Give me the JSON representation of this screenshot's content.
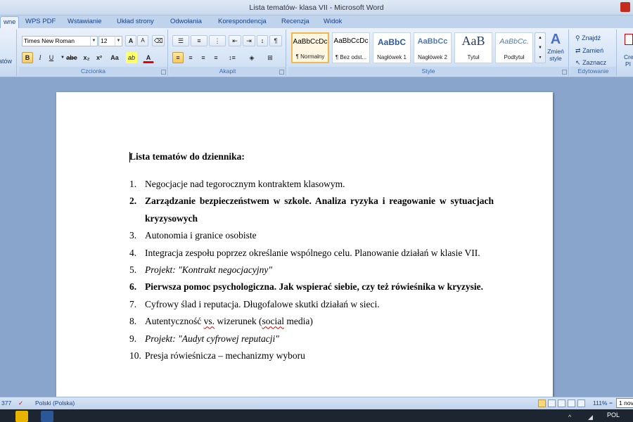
{
  "window": {
    "title": "Lista tematów- klasa VII - Microsoft Word"
  },
  "ribbon": {
    "tabs": [
      {
        "label": "wne",
        "active": true
      },
      {
        "label": "WPS PDF"
      },
      {
        "label": "Wstawianie"
      },
      {
        "label": "Układ strony"
      },
      {
        "label": "Odwołania"
      },
      {
        "label": "Korespondencja"
      },
      {
        "label": "Recenzja"
      },
      {
        "label": "Widok"
      }
    ],
    "clipboard_partial_label": "atów",
    "font": {
      "name": "Times New Roman",
      "size": "12",
      "group_label": "Czcionka",
      "grow": "A",
      "shrink": "A",
      "bold": "B",
      "italic": "I",
      "underline": "U",
      "strike": "abe",
      "subscript": "x₂",
      "superscript": "x²",
      "change_case": "Aa",
      "highlight": "ab",
      "font_color": "A"
    },
    "paragraph": {
      "group_label": "Akapit"
    },
    "styles": {
      "group_label": "Style",
      "items": [
        {
          "preview": "AaBbCcDc",
          "name": "¶ Normalny",
          "selected": true
        },
        {
          "preview": "AaBbCcDc",
          "name": "¶ Bez odst..."
        },
        {
          "preview": "AaBbC",
          "name": "Nagłówek 1"
        },
        {
          "preview": "AaBbCc",
          "name": "Nagłówek 2"
        },
        {
          "preview": "AaB",
          "name": "Tytuł"
        },
        {
          "preview": "AaBbCc.",
          "name": "Podtytuł"
        }
      ],
      "change_styles": [
        "Zmień",
        "style"
      ]
    },
    "editing": {
      "group_label": "Edytowanie",
      "find": "Znajdź",
      "replace": "Zamień",
      "select": "Zaznacz"
    },
    "pdf_partial": [
      "Cre",
      "PI"
    ]
  },
  "document": {
    "title": "Lista tematów do dziennika:",
    "items": [
      {
        "num": "1.",
        "text": "Negocjacje nad tegorocznym kontraktem klasowym.",
        "style": "normal"
      },
      {
        "num": "2.",
        "text": "Zarządzanie bezpieczeństwem w szkole. Analiza ryzyka i reagowanie w sytuacjach kryzysowych",
        "style": "bold"
      },
      {
        "num": "3.",
        "text": "Autonomia i granice osobiste",
        "style": "normal"
      },
      {
        "num": "4.",
        "text": "Integracja zespołu poprzez określanie wspólnego celu. Planowanie działań w klasie VII.",
        "style": "normal"
      },
      {
        "num": "5.",
        "text": "Projekt: \"Kontrakt negocjacyjny\"",
        "style": "italic"
      },
      {
        "num": "6.",
        "text": "Pierwsza pomoc psychologiczna. Jak wspierać siebie, czy też rówieśnika w kryzysie.",
        "style": "bold"
      },
      {
        "num": "7.",
        "text": "Cyfrowy ślad i reputacja. Długofalowe skutki działań w sieci.",
        "style": "normal"
      },
      {
        "num": "8.",
        "text_parts": [
          "Autentyczność ",
          "vs.",
          " wizerunek (",
          "social",
          " media)"
        ],
        "style": "normal"
      },
      {
        "num": "9.",
        "text": "Projekt: \"Audyt cyfrowej reputacji\"",
        "style": "italic"
      },
      {
        "num": "10.",
        "text": "Presja rówieśnicza – mechanizmy wyboru",
        "style": "normal"
      }
    ]
  },
  "statusbar": {
    "words_partial": "377",
    "language": "Polski (Polska)",
    "zoom": "111%",
    "tooltip": "1 nov"
  },
  "taskbar": {
    "language": "POL"
  }
}
